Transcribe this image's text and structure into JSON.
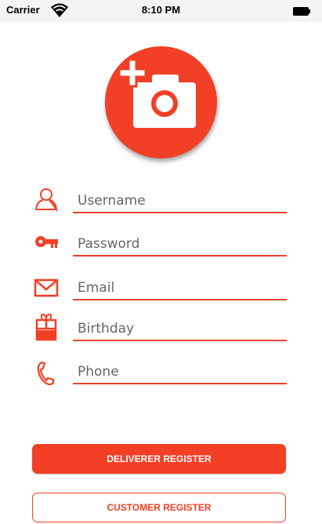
{
  "status_bar": {
    "carrier": "Carrier",
    "time": "8:10 PM"
  },
  "avatar": {
    "icon": "add-photo-icon",
    "color": "#f23f25"
  },
  "form": {
    "fields": [
      {
        "icon": "user-icon",
        "placeholder": "Username",
        "value": ""
      },
      {
        "icon": "key-icon",
        "placeholder": "Password",
        "value": ""
      },
      {
        "icon": "mail-icon",
        "placeholder": "Email",
        "value": ""
      },
      {
        "icon": "gift-icon",
        "placeholder": "Birthday",
        "value": ""
      },
      {
        "icon": "phone-icon",
        "placeholder": "Phone",
        "value": ""
      }
    ]
  },
  "buttons": {
    "deliverer_register": "DELIVERER REGISTER",
    "customer_register": "CUSTOMER REGISTER"
  },
  "colors": {
    "accent": "#f23f25",
    "underline": "#e8432d"
  }
}
